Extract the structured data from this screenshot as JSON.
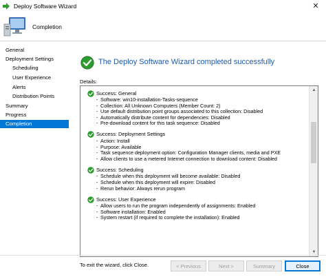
{
  "window": {
    "title": "Deploy Software Wizard",
    "close_glyph": "✕"
  },
  "header": {
    "title": "Completion"
  },
  "sidebar": {
    "items": [
      {
        "label": "General"
      },
      {
        "label": "Deployment Settings"
      },
      {
        "label": "Scheduling"
      },
      {
        "label": "User Experience"
      },
      {
        "label": "Alerts"
      },
      {
        "label": "Distribution Points"
      },
      {
        "label": "Summary"
      },
      {
        "label": "Progress"
      },
      {
        "label": "Completion"
      }
    ],
    "active_color": "#0078d7"
  },
  "main": {
    "success_title": "The Deploy Software Wizard completed successfully",
    "details_label": "Details:",
    "exit_text": "To exit the wizard, click Close.",
    "sections": [
      {
        "title": "Success: General",
        "lines": [
          "Software: win10-installation-Tasks-sequence",
          "Collection: All Unknown Computers (Member Count: 2)",
          "Use default distribution point groups associated to this collection: Disabled",
          "Automatically distribute content for dependencies: Disabled",
          "Pre-download content for this task sequence: Disabled"
        ]
      },
      {
        "title": "Success: Deployment Settings",
        "lines": [
          "Action: Install",
          "Purpose: Available",
          "Task sequence deployment option: Configuration Manager clients, media and PXE",
          "Allow clients to use a metered Internet connection to download content: Disabled"
        ]
      },
      {
        "title": "Success: Scheduling",
        "lines": [
          "Schedule when this deployment will become available: Disabled",
          "Schedule when this deployment will expire: Disabled",
          "Rerun behavior: Always rerun program"
        ]
      },
      {
        "title": "Success: User Experience",
        "lines": [
          "Allow users to run the program independently of assignments: Enabled",
          "Software installation: Enabled",
          "System restart (if required to complete the installation): Enabled"
        ]
      }
    ]
  },
  "buttons": {
    "previous": "< Previous",
    "next": "Next >",
    "summary": "Summary",
    "close": "Close"
  },
  "colors": {
    "success_green": "#2e9b2e",
    "title_blue": "#1e5aa8",
    "accent": "#0078d7"
  }
}
